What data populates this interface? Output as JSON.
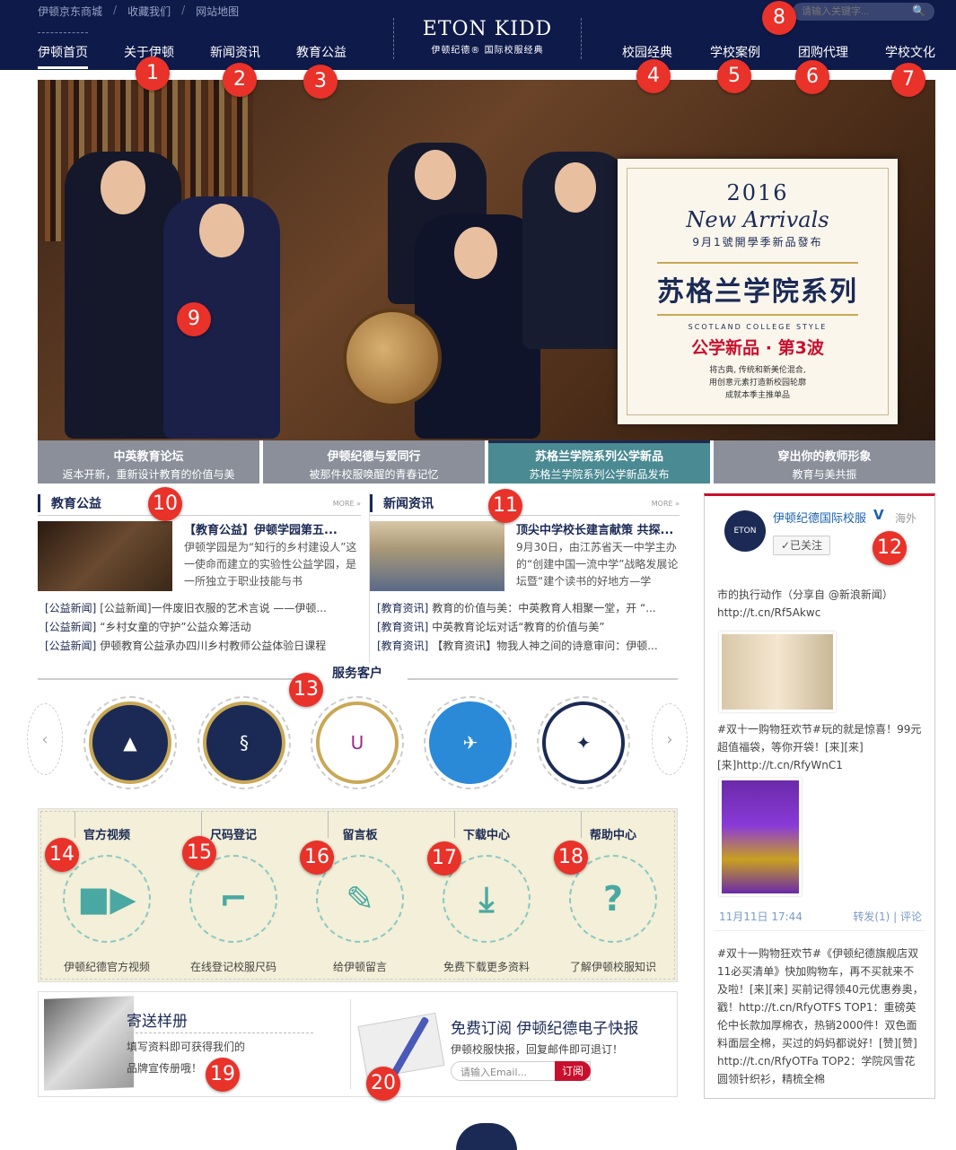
{
  "header": {
    "util_links": [
      "伊顿京东商城",
      "收藏我们",
      "网站地图"
    ],
    "util_sep": "/",
    "nav_left": [
      "伊顿首页",
      "关于伊顿",
      "新闻资讯",
      "教育公益"
    ],
    "nav_right": [
      "校园经典",
      "学校案例",
      "团购代理",
      "学校文化"
    ],
    "brand_name": "ETON KIDD",
    "brand_sub": "伊顿纪德® 国际校服经典",
    "search_placeholder": "请输入关键字...",
    "search_icon": "search-icon"
  },
  "hero": {
    "promo_year": "2016",
    "promo_new": "New Arrivals",
    "promo_date": "9月1號開學季新品發布",
    "promo_title": "苏格兰学院系列",
    "promo_style": "SCOTLAND COLLEGE STYLE",
    "promo_wave": "公学新品 · 第3波",
    "promo_lines": [
      "将古典, 传统和新美伦混合,",
      "用创意元素打造新校园轮廓",
      "成就本季主推单品"
    ]
  },
  "hero_tabs": [
    {
      "title": "中英教育论坛",
      "desc": "返本开新，重新设计教育的价值与美"
    },
    {
      "title": "伊顿纪德与爱同行",
      "desc": "被那件校服唤醒的青春记忆"
    },
    {
      "title": "苏格兰学院系列公学新品",
      "desc": "苏格兰学院系列公学新品发布"
    },
    {
      "title": "穿出你的教师形象",
      "desc": "教育与美共振"
    }
  ],
  "edu": {
    "title": "教育公益",
    "more": "MORE »",
    "headline": "【教育公益】伊顿学园第五...",
    "summary": "伊顿学园是为“知行的乡村建设人”这一使命而建立的实验性公益学园，是一所独立于职业技能与书",
    "list": [
      {
        "tag": "[公益新闻]",
        "text": "[公益新闻]一件废旧衣服的艺术言说 ——伊顿..."
      },
      {
        "tag": "[公益新闻]",
        "text": "“乡村女童的守护”公益众筹活动"
      },
      {
        "tag": "[公益新闻]",
        "text": "伊顿教育公益承办四川乡村教师公益体验日课程"
      }
    ]
  },
  "news": {
    "title": "新闻资讯",
    "more": "MORE »",
    "headline": "顶尖中学校长建言献策 共探...",
    "summary": "9月30日，由江苏省天一中学主办的“创建中国一流中学”战略发展论坛暨“建个读书的好地方—学",
    "list": [
      {
        "tag": "[教育资讯]",
        "text": "教育的价值与美：中英教育人相聚一堂，开 “..."
      },
      {
        "tag": "[教育资讯]",
        "text": "中英教育论坛对话“教育的价值与美”"
      },
      {
        "tag": "[教育资讯]",
        "text": "【教育资讯】物我人神之间的诗意审问：伊顿..."
      }
    ]
  },
  "clients": {
    "title": "服务客户",
    "prev_icon": "arrow-left-icon",
    "next_icon": "arrow-right-icon",
    "logos": [
      "school-crest-icon",
      "school-crest-icon",
      "school-crest-icon",
      "school-crest-icon",
      "school-crest-icon"
    ]
  },
  "services": [
    {
      "title": "官方视频",
      "footer": "伊顿纪德官方视频",
      "icon": "video-camera-icon"
    },
    {
      "title": "尺码登记",
      "footer": "在线登记校服尺码",
      "icon": "ruler-icon"
    },
    {
      "title": "留言板",
      "footer": "给伊顿留言",
      "icon": "edit-icon"
    },
    {
      "title": "下载中心",
      "footer": "免费下载更多资料",
      "icon": "download-icon"
    },
    {
      "title": "帮助中心",
      "footer": "了解伊顿校服知识",
      "icon": "question-icon"
    }
  ],
  "sample": {
    "title": "寄送样册",
    "line1": "填写资料即可获得我们的",
    "line2": "品牌宣传册哦！"
  },
  "subscribe": {
    "title": "免费订阅 伊顿纪德电子快报",
    "desc": "伊顿校服快报，回复邮件即可退订！",
    "placeholder": "请输入Email...",
    "button": "订阅"
  },
  "weibo": {
    "name": "伊顿纪德国际校服",
    "verified": "V",
    "location": "海外",
    "follow": "✓已关注",
    "post1": "市的执行动作（分享自 @新浪新闻）http://t.cn/Rf5Akwc",
    "post2": "#双十一购物狂欢节#玩的就是惊喜！99元超值福袋，等你开袋！[来][来][来]http://t.cn/RfyWnC1",
    "time": "11月11日 17:44",
    "actions": "转发(1) | 评论",
    "post3": "#双十一购物狂欢节#《伊顿纪德旗舰店双11必买清单》快加购物车，再不买就来不及啦！[来][来] 买前记得领40元优惠券奥，戳！http://t.cn/RfyOTFS TOP1：重磅英伦中长款加厚棉衣，热销2000件！双色面料面层全棉，买过的妈妈都说好！[赞][赞] http://t.cn/RfyOTFa TOP2：学院风雪花圆领针织衫，精梳全棉"
  },
  "badges": [
    "1",
    "2",
    "3",
    "4",
    "5",
    "6",
    "7",
    "8",
    "9",
    "10",
    "11",
    "12",
    "13",
    "14",
    "15",
    "16",
    "17",
    "18",
    "19",
    "20"
  ],
  "colors": {
    "navy": "#0e1a4a",
    "accent_red": "#c8102e",
    "teal": "#4a8a92",
    "badge_red": "#e8322a"
  }
}
